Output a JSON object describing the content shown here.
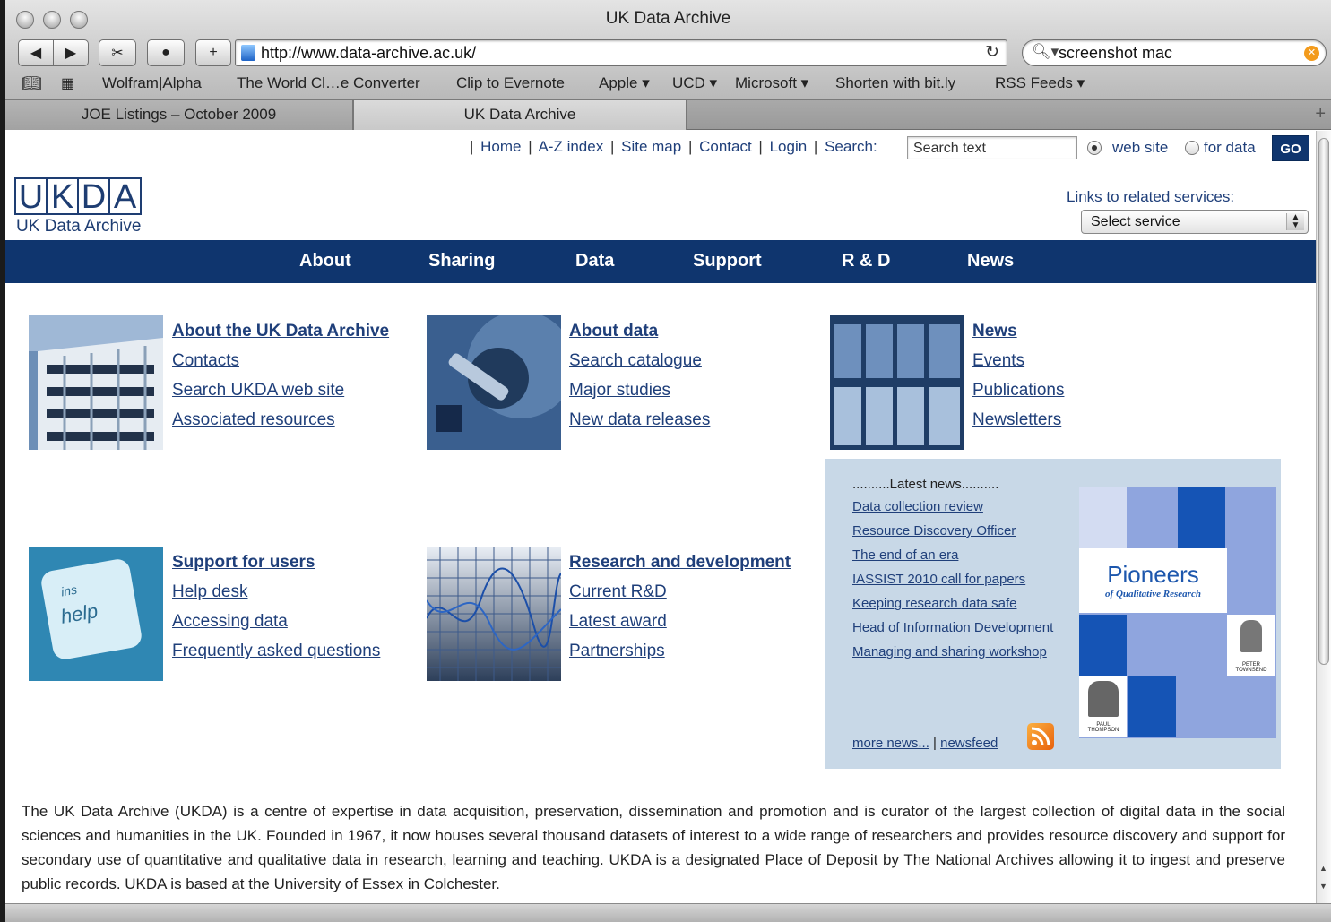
{
  "window": {
    "title": "UK Data Archive"
  },
  "toolbar": {
    "url": "http://www.data-archive.ac.uk/",
    "search_query": "screenshot mac"
  },
  "bookmarks": [
    {
      "label": "Wolfram|Alpha"
    },
    {
      "label": "The World Cl…e Converter"
    },
    {
      "label": "Clip to Evernote"
    },
    {
      "label": "Apple ▾"
    },
    {
      "label": "UCD ▾"
    },
    {
      "label": "Microsoft ▾"
    },
    {
      "label": "Shorten with bit.ly"
    },
    {
      "label": "RSS Feeds ▾"
    }
  ],
  "tabs": [
    {
      "label": "JOE Listings – October 2009"
    },
    {
      "label": "UK Data Archive"
    }
  ],
  "topnav": {
    "links": [
      "Home",
      "A-Z index",
      "Site map",
      "Contact",
      "Login"
    ],
    "search_label": "Search:",
    "search_placeholder": "Search text",
    "radio_web": "web site",
    "radio_data": "for data",
    "go": "GO"
  },
  "logo": {
    "letters": [
      "U",
      "K",
      "D",
      "A"
    ],
    "subtitle": "UK Data Archive"
  },
  "related": {
    "label": "Links to related services:",
    "selected": "Select service"
  },
  "mainnav": [
    "About",
    "Sharing",
    "Data",
    "Support",
    "R & D",
    "News"
  ],
  "sections": [
    {
      "heading": "About the UK Data Archive",
      "links": [
        "Contacts",
        "Search UKDA web site",
        "Associated resources"
      ]
    },
    {
      "heading": "About data",
      "links": [
        "Search catalogue",
        "Major studies",
        "New data releases"
      ]
    },
    {
      "heading": "News",
      "links": [
        "Events",
        "Publications",
        "Newsletters"
      ]
    },
    {
      "heading": "Support for users",
      "links": [
        "Help desk",
        "Accessing data",
        "Frequently asked questions"
      ]
    },
    {
      "heading": "Research and development",
      "links": [
        "Current R&D",
        "Latest award",
        "Partnerships"
      ]
    }
  ],
  "latest_news": {
    "heading": "..........Latest news..........",
    "items": [
      "Data collection review",
      "Resource Discovery Officer",
      "The end of an era",
      "IASSIST 2010 call for papers",
      "Keeping research data safe",
      "Head of Information Development",
      "Managing and sharing workshop"
    ],
    "more": "more news...",
    "sep": "|",
    "feed": "newsfeed"
  },
  "pioneers": {
    "title": "Pioneers",
    "subtitle": "of Qualitative Research",
    "caption1": "PETER TOWNSEND",
    "caption2": "PAUL THOMPSON"
  },
  "about_text": "The UK Data Archive (UKDA) is a centre of expertise in data acquisition, preservation, dissemination and promotion and is curator of the largest collection of digital data in the social sciences and humanities in the UK. Founded in 1967, it now houses several thousand datasets of interest to a wide range of researchers and provides resource discovery and support for secondary use of quantitative and qualitative data in research, learning and teaching. UKDA is a designated Place of Deposit by The National Archives allowing it to ingest and preserve public records. UKDA is based at the University of Essex in Colchester."
}
